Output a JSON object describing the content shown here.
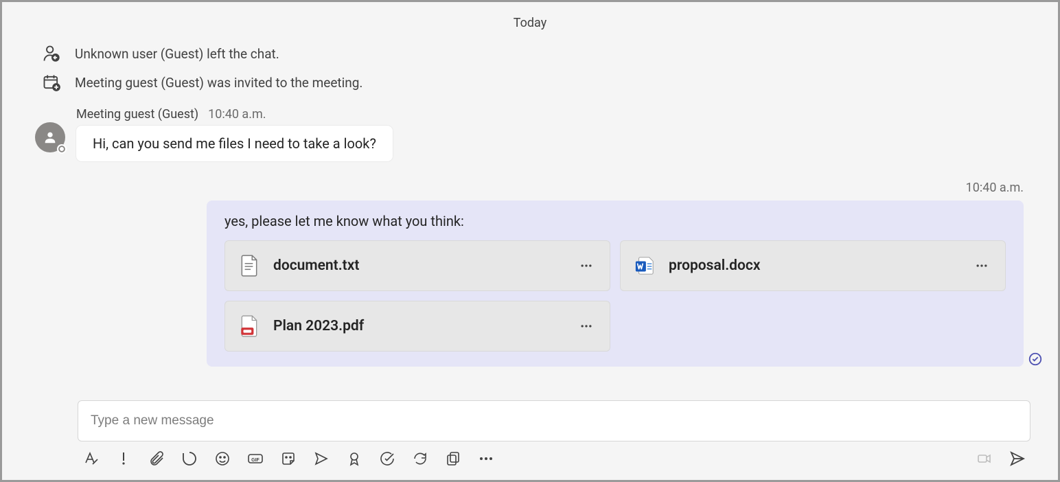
{
  "date_label": "Today",
  "system_events": [
    {
      "text": "Unknown user (Guest) left the chat."
    },
    {
      "text": "Meeting guest (Guest) was invited to the meeting."
    }
  ],
  "incoming_message": {
    "sender": "Meeting guest (Guest)",
    "timestamp": "10:40 a.m.",
    "text": "Hi, can you send me files I need to take a look?"
  },
  "outgoing_message": {
    "timestamp": "10:40 a.m.",
    "text": "yes, please let me know what you think:",
    "attachments": [
      {
        "name": "document.txt",
        "type": "txt"
      },
      {
        "name": "proposal.docx",
        "type": "docx"
      },
      {
        "name": "Plan 2023.pdf",
        "type": "pdf"
      }
    ]
  },
  "compose": {
    "placeholder": "Type a new message"
  },
  "colors": {
    "outgoing_bubble": "#e5e5f7",
    "accent": "#4f52b2"
  }
}
